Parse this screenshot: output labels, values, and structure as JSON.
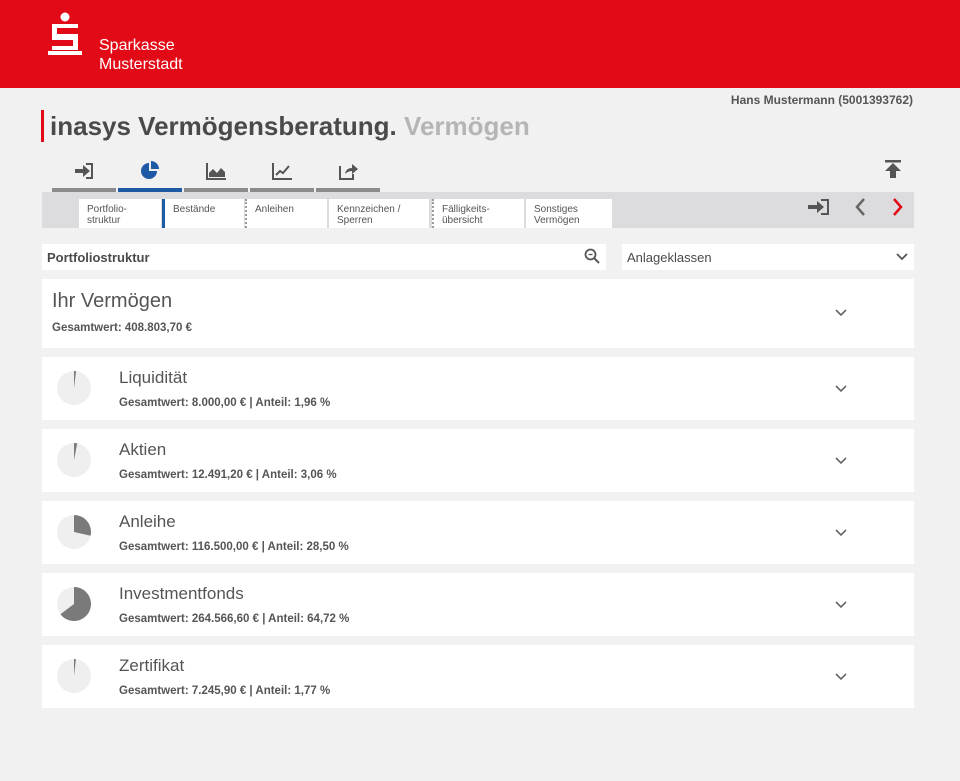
{
  "header": {
    "brand_line1": "Sparkasse",
    "brand_line2": "Musterstadt",
    "brand_color": "#e20a16"
  },
  "user": "Hans Mustermann (5001393762)",
  "title": {
    "main": "inasys Vermögensberatung.",
    "sub": "Vermögen"
  },
  "icon_tabs": [
    {
      "icon": "login-arrow-icon"
    },
    {
      "icon": "pie-chart-icon",
      "active": true
    },
    {
      "icon": "area-chart-icon"
    },
    {
      "icon": "line-chart-icon"
    },
    {
      "icon": "share-icon"
    }
  ],
  "subtabs": [
    {
      "label": "Portfolio-\nstruktur"
    },
    {
      "label": "Bestände",
      "active": true
    },
    {
      "label": "Anleihen"
    },
    {
      "label": "Kennzeichen /\nSperren"
    },
    {
      "label": "Fälligkeits-\nübersicht"
    },
    {
      "label": "Sonstiges\nVermögen"
    }
  ],
  "search": {
    "label": "Portfoliostruktur"
  },
  "select": {
    "value": "Anlageklassen"
  },
  "summary": {
    "title": "Ihr Vermögen",
    "total": "Gesamtwert: 408.803,70 €"
  },
  "assets": [
    {
      "name": "Liquidität",
      "detail": "Gesamtwert: 8.000,00 € | Anteil: 1,96 %",
      "share": 1.96
    },
    {
      "name": "Aktien",
      "detail": "Gesamtwert: 12.491,20 € | Anteil: 3,06 %",
      "share": 3.06
    },
    {
      "name": "Anleihe",
      "detail": "Gesamtwert: 116.500,00 € | Anteil: 28,50 %",
      "share": 28.5
    },
    {
      "name": "Investmentfonds",
      "detail": "Gesamtwert: 264.566,60 € | Anteil: 64,72 %",
      "share": 64.72
    },
    {
      "name": "Zertifikat",
      "detail": "Gesamtwert: 7.245,90 € | Anteil: 1,77 %",
      "share": 1.77
    }
  ],
  "colors": {
    "active_tab": "#1f5aa6",
    "pie_fill": "#7a7a7a",
    "pie_bg": "#efefef",
    "next_arrow": "#e20a16"
  }
}
